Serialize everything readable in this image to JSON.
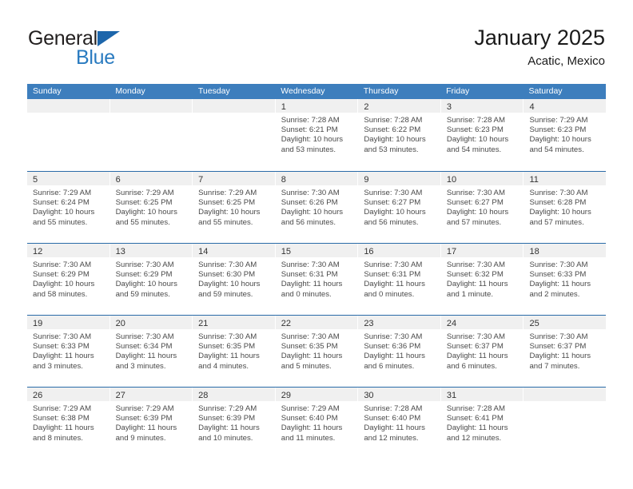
{
  "brand": {
    "name_part1": "General",
    "name_part2": "Blue",
    "triangle_icon": "triangle-icon",
    "accent_color": "#2a7bc0"
  },
  "header": {
    "title": "January 2025",
    "subtitle": "Acatic, Mexico"
  },
  "theme": {
    "header_blue": "#3d7ebd",
    "row_rule_blue": "#2a6ba8",
    "daynum_band": "#f0f0f0"
  },
  "weekdays": [
    "Sunday",
    "Monday",
    "Tuesday",
    "Wednesday",
    "Thursday",
    "Friday",
    "Saturday"
  ],
  "weeks": [
    [
      {
        "day": "",
        "lines": []
      },
      {
        "day": "",
        "lines": []
      },
      {
        "day": "",
        "lines": []
      },
      {
        "day": "1",
        "lines": [
          "Sunrise: 7:28 AM",
          "Sunset: 6:21 PM",
          "Daylight: 10 hours",
          "and 53 minutes."
        ]
      },
      {
        "day": "2",
        "lines": [
          "Sunrise: 7:28 AM",
          "Sunset: 6:22 PM",
          "Daylight: 10 hours",
          "and 53 minutes."
        ]
      },
      {
        "day": "3",
        "lines": [
          "Sunrise: 7:28 AM",
          "Sunset: 6:23 PM",
          "Daylight: 10 hours",
          "and 54 minutes."
        ]
      },
      {
        "day": "4",
        "lines": [
          "Sunrise: 7:29 AM",
          "Sunset: 6:23 PM",
          "Daylight: 10 hours",
          "and 54 minutes."
        ]
      }
    ],
    [
      {
        "day": "5",
        "lines": [
          "Sunrise: 7:29 AM",
          "Sunset: 6:24 PM",
          "Daylight: 10 hours",
          "and 55 minutes."
        ]
      },
      {
        "day": "6",
        "lines": [
          "Sunrise: 7:29 AM",
          "Sunset: 6:25 PM",
          "Daylight: 10 hours",
          "and 55 minutes."
        ]
      },
      {
        "day": "7",
        "lines": [
          "Sunrise: 7:29 AM",
          "Sunset: 6:25 PM",
          "Daylight: 10 hours",
          "and 55 minutes."
        ]
      },
      {
        "day": "8",
        "lines": [
          "Sunrise: 7:30 AM",
          "Sunset: 6:26 PM",
          "Daylight: 10 hours",
          "and 56 minutes."
        ]
      },
      {
        "day": "9",
        "lines": [
          "Sunrise: 7:30 AM",
          "Sunset: 6:27 PM",
          "Daylight: 10 hours",
          "and 56 minutes."
        ]
      },
      {
        "day": "10",
        "lines": [
          "Sunrise: 7:30 AM",
          "Sunset: 6:27 PM",
          "Daylight: 10 hours",
          "and 57 minutes."
        ]
      },
      {
        "day": "11",
        "lines": [
          "Sunrise: 7:30 AM",
          "Sunset: 6:28 PM",
          "Daylight: 10 hours",
          "and 57 minutes."
        ]
      }
    ],
    [
      {
        "day": "12",
        "lines": [
          "Sunrise: 7:30 AM",
          "Sunset: 6:29 PM",
          "Daylight: 10 hours",
          "and 58 minutes."
        ]
      },
      {
        "day": "13",
        "lines": [
          "Sunrise: 7:30 AM",
          "Sunset: 6:29 PM",
          "Daylight: 10 hours",
          "and 59 minutes."
        ]
      },
      {
        "day": "14",
        "lines": [
          "Sunrise: 7:30 AM",
          "Sunset: 6:30 PM",
          "Daylight: 10 hours",
          "and 59 minutes."
        ]
      },
      {
        "day": "15",
        "lines": [
          "Sunrise: 7:30 AM",
          "Sunset: 6:31 PM",
          "Daylight: 11 hours",
          "and 0 minutes."
        ]
      },
      {
        "day": "16",
        "lines": [
          "Sunrise: 7:30 AM",
          "Sunset: 6:31 PM",
          "Daylight: 11 hours",
          "and 0 minutes."
        ]
      },
      {
        "day": "17",
        "lines": [
          "Sunrise: 7:30 AM",
          "Sunset: 6:32 PM",
          "Daylight: 11 hours",
          "and 1 minute."
        ]
      },
      {
        "day": "18",
        "lines": [
          "Sunrise: 7:30 AM",
          "Sunset: 6:33 PM",
          "Daylight: 11 hours",
          "and 2 minutes."
        ]
      }
    ],
    [
      {
        "day": "19",
        "lines": [
          "Sunrise: 7:30 AM",
          "Sunset: 6:33 PM",
          "Daylight: 11 hours",
          "and 3 minutes."
        ]
      },
      {
        "day": "20",
        "lines": [
          "Sunrise: 7:30 AM",
          "Sunset: 6:34 PM",
          "Daylight: 11 hours",
          "and 3 minutes."
        ]
      },
      {
        "day": "21",
        "lines": [
          "Sunrise: 7:30 AM",
          "Sunset: 6:35 PM",
          "Daylight: 11 hours",
          "and 4 minutes."
        ]
      },
      {
        "day": "22",
        "lines": [
          "Sunrise: 7:30 AM",
          "Sunset: 6:35 PM",
          "Daylight: 11 hours",
          "and 5 minutes."
        ]
      },
      {
        "day": "23",
        "lines": [
          "Sunrise: 7:30 AM",
          "Sunset: 6:36 PM",
          "Daylight: 11 hours",
          "and 6 minutes."
        ]
      },
      {
        "day": "24",
        "lines": [
          "Sunrise: 7:30 AM",
          "Sunset: 6:37 PM",
          "Daylight: 11 hours",
          "and 6 minutes."
        ]
      },
      {
        "day": "25",
        "lines": [
          "Sunrise: 7:30 AM",
          "Sunset: 6:37 PM",
          "Daylight: 11 hours",
          "and 7 minutes."
        ]
      }
    ],
    [
      {
        "day": "26",
        "lines": [
          "Sunrise: 7:29 AM",
          "Sunset: 6:38 PM",
          "Daylight: 11 hours",
          "and 8 minutes."
        ]
      },
      {
        "day": "27",
        "lines": [
          "Sunrise: 7:29 AM",
          "Sunset: 6:39 PM",
          "Daylight: 11 hours",
          "and 9 minutes."
        ]
      },
      {
        "day": "28",
        "lines": [
          "Sunrise: 7:29 AM",
          "Sunset: 6:39 PM",
          "Daylight: 11 hours",
          "and 10 minutes."
        ]
      },
      {
        "day": "29",
        "lines": [
          "Sunrise: 7:29 AM",
          "Sunset: 6:40 PM",
          "Daylight: 11 hours",
          "and 11 minutes."
        ]
      },
      {
        "day": "30",
        "lines": [
          "Sunrise: 7:28 AM",
          "Sunset: 6:40 PM",
          "Daylight: 11 hours",
          "and 12 minutes."
        ]
      },
      {
        "day": "31",
        "lines": [
          "Sunrise: 7:28 AM",
          "Sunset: 6:41 PM",
          "Daylight: 11 hours",
          "and 12 minutes."
        ]
      },
      {
        "day": "",
        "lines": []
      }
    ]
  ]
}
